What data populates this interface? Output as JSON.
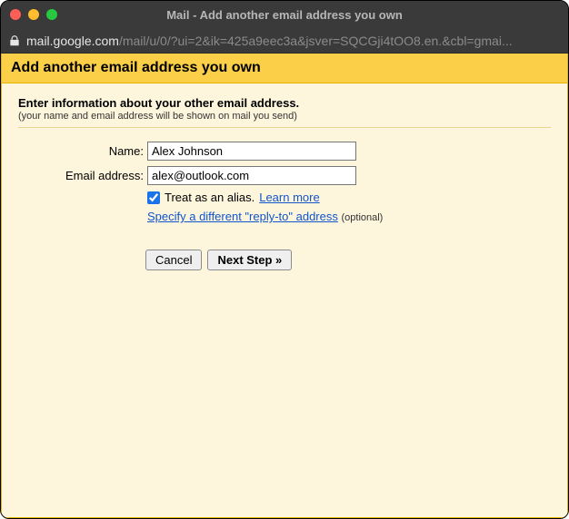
{
  "window": {
    "title": "Mail - Add another email address you own"
  },
  "addressbar": {
    "domain": "mail.google.com",
    "path": "/mail/u/0/?ui=2&ik=425a9eec3a&jsver=SQCGji4tOO8.en.&cbl=gmai..."
  },
  "banner": {
    "heading": "Add another email address you own"
  },
  "intro": {
    "title": "Enter information about your other email address.",
    "subtitle": "(your name and email address will be shown on mail you send)"
  },
  "form": {
    "name_label": "Name:",
    "name_value": "Alex Johnson",
    "email_label": "Email address:",
    "email_value": "alex@outlook.com",
    "alias_checked": true,
    "alias_label": "Treat as an alias.",
    "learn_more": "Learn more",
    "reply_to_link": "Specify a different \"reply-to\" address",
    "optional": "(optional)"
  },
  "buttons": {
    "cancel": "Cancel",
    "next": "Next Step »"
  }
}
